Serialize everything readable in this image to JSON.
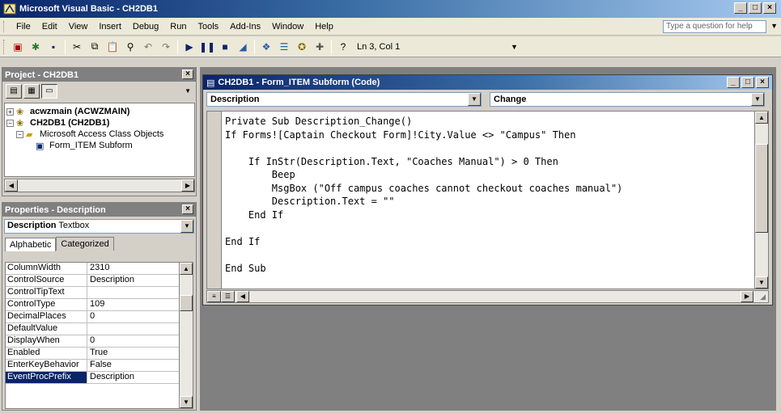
{
  "window": {
    "title": "Microsoft Visual Basic - CH2DB1"
  },
  "menu": {
    "items": [
      "File",
      "Edit",
      "View",
      "Insert",
      "Debug",
      "Run",
      "Tools",
      "Add-Ins",
      "Window",
      "Help"
    ],
    "help_placeholder": "Type a question for help"
  },
  "toolbar": {
    "status": "Ln 3, Col 1"
  },
  "project": {
    "title": "Project - CH2DB1",
    "tree": [
      {
        "label": "acwzmain (ACWZMAIN)",
        "bold": true
      },
      {
        "label": "CH2DB1 (CH2DB1)",
        "bold": true
      },
      {
        "label": "Microsoft Access Class Objects",
        "bold": false
      },
      {
        "label": "Form_ITEM Subform",
        "bold": false
      }
    ]
  },
  "properties": {
    "title": "Properties - Description",
    "object_name": "Description",
    "object_type": "Textbox",
    "tabs": [
      "Alphabetic",
      "Categorized"
    ],
    "rows": [
      {
        "key": "ColumnWidth",
        "value": "2310"
      },
      {
        "key": "ControlSource",
        "value": "Description"
      },
      {
        "key": "ControlTipText",
        "value": ""
      },
      {
        "key": "ControlType",
        "value": "109"
      },
      {
        "key": "DecimalPlaces",
        "value": "0"
      },
      {
        "key": "DefaultValue",
        "value": ""
      },
      {
        "key": "DisplayWhen",
        "value": "0"
      },
      {
        "key": "Enabled",
        "value": "True"
      },
      {
        "key": "EnterKeyBehavior",
        "value": "False"
      },
      {
        "key": "EventProcPrefix",
        "value": "Description"
      }
    ],
    "selected_key": "EventProcPrefix"
  },
  "code_window": {
    "title": "CH2DB1 - Form_ITEM Subform (Code)",
    "object_dropdown": "Description",
    "procedure_dropdown": "Change",
    "lines": [
      "Private Sub Description_Change()",
      "If Forms![Captain Checkout Form]!City.Value <> \"Campus\" Then",
      "",
      "    If InStr(Description.Text, \"Coaches Manual\") > 0 Then",
      "        Beep",
      "        MsgBox (\"Off campus coaches cannot checkout coaches manual\")",
      "        Description.Text = \"\"",
      "    End If",
      "",
      "End If",
      "",
      "End Sub"
    ]
  },
  "colors": {
    "titlebar_start": "#0a246a",
    "titlebar_end": "#a6caf0",
    "face": "#d4d0c8",
    "mdi_background": "#808080"
  }
}
